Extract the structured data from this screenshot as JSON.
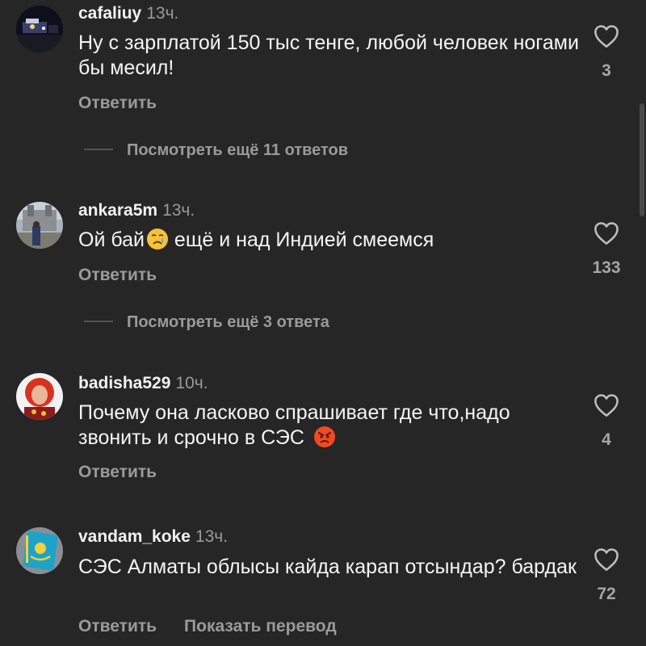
{
  "comments": [
    {
      "username": "cafaliuy",
      "time": "13ч.",
      "text": "Ну с зарплатой 150 тыс тенге, любой человек ногами бы месил!",
      "likes": "3",
      "reply_label": "Ответить",
      "more_replies": "Посмотреть ещё 11 ответов"
    },
    {
      "username": "ankara5m",
      "time": "13ч.",
      "text_before_emoji": "Ой бай",
      "emoji": "crying-face-emoji",
      "text_after_emoji": " ещё и над Индией смеемся",
      "likes": "133",
      "reply_label": "Ответить",
      "more_replies": "Посмотреть ещё 3 ответа"
    },
    {
      "username": "badisha529",
      "time": "10ч.",
      "text": "Почему она ласково спрашивает где что,надо звонить и срочно в СЭС ",
      "emoji": "angry-face-emoji",
      "likes": "4",
      "reply_label": "Ответить"
    },
    {
      "username": "vandam_koke",
      "time": "13ч.",
      "text": "СЭС Алматы облысы кайда карап отсындар? бардак",
      "likes": "72",
      "reply_label": "Ответить",
      "translate_label": "Показать перевод"
    }
  ],
  "colors": {
    "background": "#262626",
    "secondary_text": "#9a9a9a",
    "primary_text": "#f5f5f5"
  }
}
